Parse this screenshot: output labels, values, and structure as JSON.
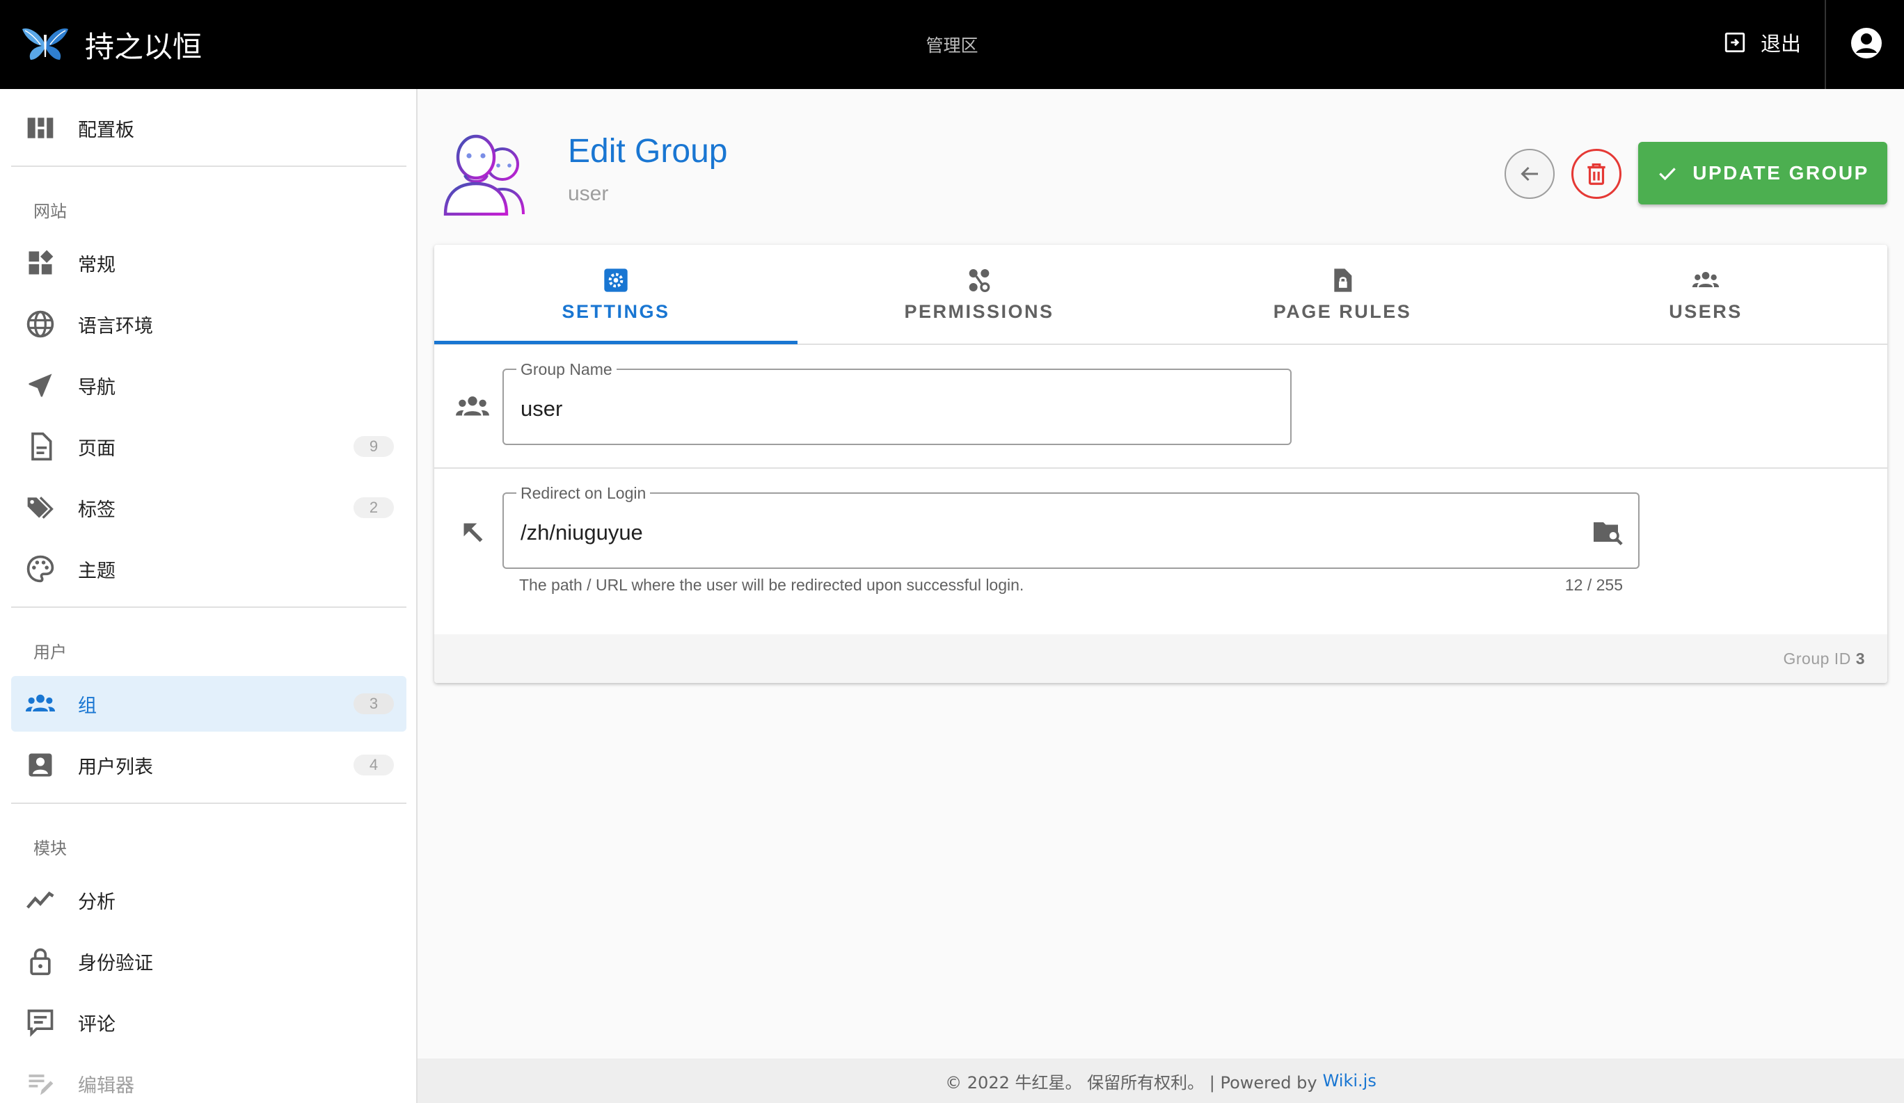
{
  "app": {
    "title": "持之以恒",
    "section": "管理区",
    "logout_label": "退出"
  },
  "sidebar": {
    "dashboard": {
      "label": "配置板"
    },
    "sections": {
      "site": "网站",
      "users": "用户",
      "modules": "模块"
    },
    "site_items": [
      {
        "label": "常规"
      },
      {
        "label": "语言环境"
      },
      {
        "label": "导航"
      },
      {
        "label": "页面",
        "count": "9"
      },
      {
        "label": "标签",
        "count": "2"
      },
      {
        "label": "主题"
      }
    ],
    "user_items": [
      {
        "label": "组",
        "count": "3"
      },
      {
        "label": "用户列表",
        "count": "4"
      }
    ],
    "module_items": [
      {
        "label": "分析"
      },
      {
        "label": "身份验证"
      },
      {
        "label": "评论"
      },
      {
        "label": "编辑器"
      }
    ]
  },
  "header": {
    "title": "Edit Group",
    "subtitle": "user",
    "update_label": "UPDATE GROUP"
  },
  "tabs": [
    {
      "label": "SETTINGS",
      "icon": "settings-icon",
      "active": true
    },
    {
      "label": "PERMISSIONS",
      "icon": "permissions-icon"
    },
    {
      "label": "PAGE RULES",
      "icon": "page-rules-icon"
    },
    {
      "label": "USERS",
      "icon": "users-icon"
    }
  ],
  "form": {
    "group_name": {
      "label": "Group Name",
      "value": "user"
    },
    "redirect": {
      "label": "Redirect on Login",
      "value": "/zh/niuguyue",
      "hint": "The path / URL where the user will be redirected upon successful login.",
      "counter": "12 / 255"
    }
  },
  "footer_card": {
    "group_id_label": "Group ID",
    "group_id": "3"
  },
  "page_footer": {
    "text": "© 2022 牛红星。 保留所有权利。 | Powered by",
    "link": "Wiki.js"
  },
  "colors": {
    "accent": "#1976d2",
    "update": "#4caf50",
    "delete": "#e53935",
    "topbar": "#000000"
  }
}
